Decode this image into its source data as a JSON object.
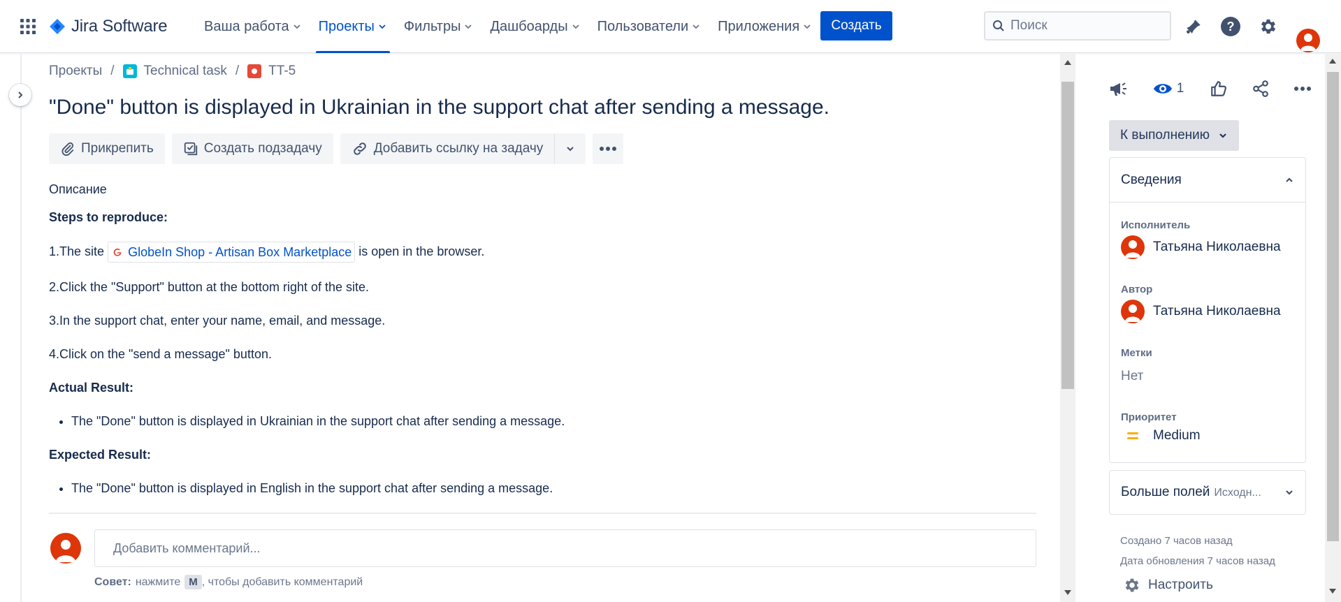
{
  "app": {
    "name": "Jira Software"
  },
  "nav": {
    "items": [
      {
        "label": "Ваша работа",
        "active": false
      },
      {
        "label": "Проекты",
        "active": true
      },
      {
        "label": "Фильтры",
        "active": false
      },
      {
        "label": "Дашбоарды",
        "active": false
      },
      {
        "label": "Пользователи",
        "active": false
      },
      {
        "label": "Приложения",
        "active": false
      }
    ],
    "create_label": "Создать",
    "search_placeholder": "Поиск",
    "icons": [
      "notifications-icon",
      "help-icon",
      "settings-icon",
      "avatar"
    ]
  },
  "breadcrumb": {
    "projects": "Проекты",
    "project": "Technical task",
    "issue_key": "TT-5"
  },
  "issue": {
    "title": "\"Done\" button is displayed in Ukrainian in the support chat after sending a message.",
    "toolbar": {
      "attach": "Прикрепить",
      "subtask": "Создать подзадачу",
      "link_issue": "Добавить ссылку на задачу"
    },
    "description_label": "Описание",
    "description": {
      "steps_heading": "Steps to reproduce:",
      "step1_prefix": "1.The site",
      "step1_link": "GlobeIn Shop - Artisan Box Marketplace",
      "step1_suffix": "is open in the browser.",
      "step2": "2.Click the \"Support\" button at the bottom right of the site.",
      "step3": "3.In the support chat, enter your name, email, and message.",
      "step4": "4.Click on the \"send a message\" button.",
      "actual_heading": "Actual Result:",
      "actual_item": "The \"Done\" button is displayed in Ukrainian in the support chat after sending a message.",
      "expected_heading": "Expected Result:",
      "expected_item": "The \"Done\" button is displayed in English in the support chat after sending a message."
    },
    "comment_placeholder": "Добавить комментарий...",
    "tip_label": "Совет:",
    "tip_press": "нажмите",
    "tip_key": "M",
    "tip_rest": ", чтобы добавить комментарий"
  },
  "sidebar": {
    "watch_count": "1",
    "status": "К выполнению",
    "details_title": "Сведения",
    "assignee_label": "Исполнитель",
    "assignee": "Татьяна Николаевна",
    "reporter_label": "Автор",
    "reporter": "Татьяна Николаевна",
    "labels_label": "Метки",
    "labels_value": "Нет",
    "priority_label": "Приоритет",
    "priority": "Medium",
    "more_fields": "Больше полей",
    "more_fields_sub": "Исходн...",
    "created": "Создано 7 часов назад",
    "updated": "Дата обновления 7 часов назад",
    "configure": "Настроить"
  },
  "colors": {
    "brand": "#0052cc",
    "avatar": "#de350b",
    "priority_medium": "#ffab00",
    "favicon": "#ea4335"
  }
}
